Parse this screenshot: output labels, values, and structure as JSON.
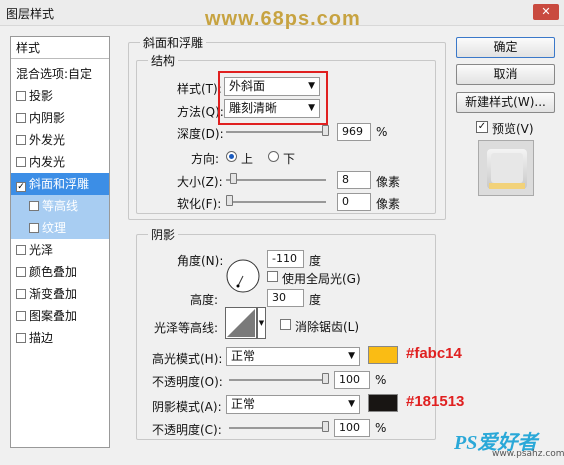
{
  "window": {
    "title": "图层样式",
    "close": "✕"
  },
  "watermark": "www.68ps.com",
  "sidebar": {
    "header": "样式",
    "items": [
      {
        "label": "混合选项:自定",
        "check": ""
      },
      {
        "label": "投影",
        "check": "☐"
      },
      {
        "label": "内阴影",
        "check": "☐"
      },
      {
        "label": "外发光",
        "check": "☐"
      },
      {
        "label": "内发光",
        "check": "☐"
      },
      {
        "label": "斜面和浮雕",
        "check": "☑"
      },
      {
        "label": "等高线",
        "check": "☐"
      },
      {
        "label": "纹理",
        "check": "☐"
      },
      {
        "label": "光泽",
        "check": "☐"
      },
      {
        "label": "颜色叠加",
        "check": "☐"
      },
      {
        "label": "渐变叠加",
        "check": "☐"
      },
      {
        "label": "图案叠加",
        "check": "☐"
      },
      {
        "label": "描边",
        "check": "☐"
      }
    ]
  },
  "bevel": {
    "title": "斜面和浮雕",
    "structure": {
      "title": "结构",
      "style_label": "样式(T):",
      "style_value": "外斜面",
      "technique_label": "方法(Q):",
      "technique_value": "雕刻清晰",
      "depth_label": "深度(D):",
      "depth_value": "969",
      "depth_unit": "%",
      "depth_fraction": 1.0,
      "direction_label": "方向:",
      "dir_up": "上",
      "dir_down": "下",
      "size_label": "大小(Z):",
      "size_value": "8",
      "size_unit": "像素",
      "size_fraction": 0.04,
      "soften_label": "软化(F):",
      "soften_value": "0",
      "soften_unit": "像素",
      "soften_fraction": 0.0
    },
    "shading": {
      "title": "阴影",
      "angle_label": "角度(N):",
      "angle_value": "-110",
      "angle_unit": "度",
      "global_light_label": "使用全局光(G)",
      "altitude_label": "高度:",
      "altitude_value": "30",
      "altitude_unit": "度",
      "gloss_label": "光泽等高线:",
      "antialias_label": "消除锯齿(L)",
      "highlight_label": "高光模式(H):",
      "highlight_value": "正常",
      "highlight_color": "#fabc14",
      "hl_opacity_label": "不透明度(O):",
      "hl_opacity_value": "100",
      "hl_opacity_unit": "%",
      "shadow_label": "阴影模式(A):",
      "shadow_value": "正常",
      "shadow_color": "#181513",
      "sh_opacity_label": "不透明度(C):",
      "sh_opacity_value": "100",
      "sh_opacity_unit": "%"
    }
  },
  "buttons": {
    "ok": "确定",
    "cancel": "取消",
    "new_style": "新建样式(W)...",
    "preview": "预览(V)"
  },
  "annotations": {
    "highlight_color": "#fabc14",
    "shadow_color": "#181513"
  },
  "logo": {
    "text": "PS爱好者",
    "url": "www.psahz.com"
  }
}
